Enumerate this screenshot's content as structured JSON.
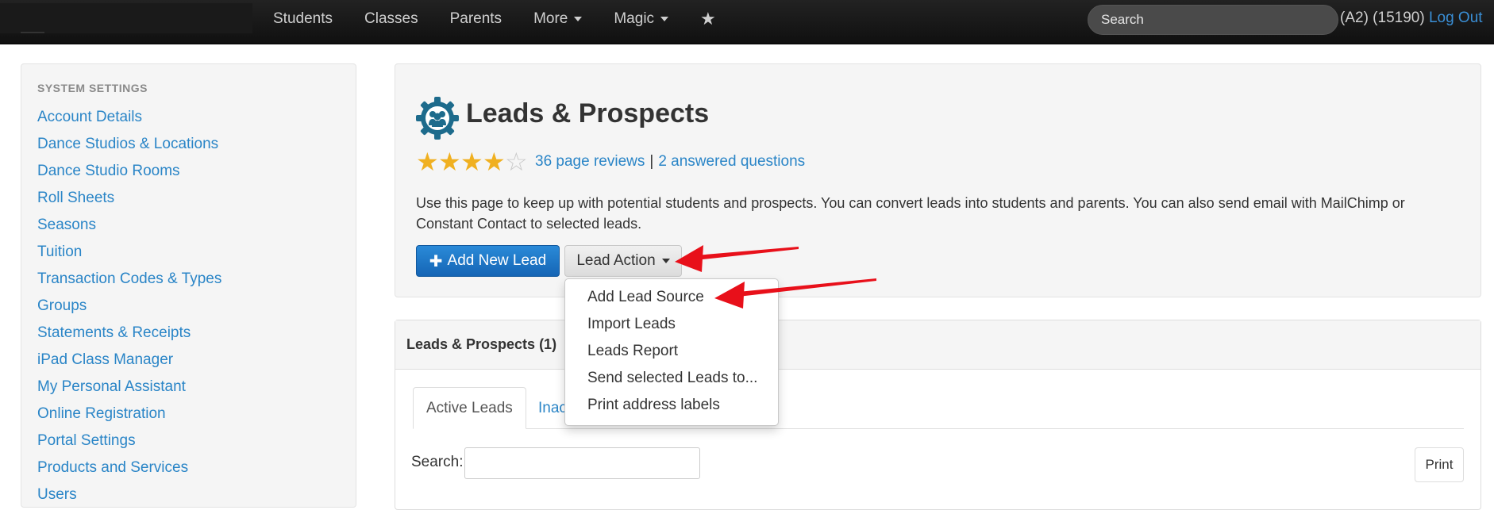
{
  "navbar": {
    "links": [
      {
        "label": "Students"
      },
      {
        "label": "Classes"
      },
      {
        "label": "Parents"
      },
      {
        "label": "More"
      },
      {
        "label": "Magic"
      }
    ],
    "star_icon": "star-icon",
    "search_placeholder": "Search",
    "user_info": "(A2) (15190)",
    "logout_label": "Log Out"
  },
  "sidebar": {
    "heading": "SYSTEM SETTINGS",
    "items": [
      {
        "label": "Account Details"
      },
      {
        "label": "Dance Studios & Locations"
      },
      {
        "label": "Dance Studio Rooms"
      },
      {
        "label": "Roll Sheets"
      },
      {
        "label": "Seasons"
      },
      {
        "label": "Tuition"
      },
      {
        "label": "Transaction Codes & Types"
      },
      {
        "label": "Groups"
      },
      {
        "label": "Statements & Receipts"
      },
      {
        "label": "iPad Class Manager"
      },
      {
        "label": "My Personal Assistant"
      },
      {
        "label": "Online Registration"
      },
      {
        "label": "Portal Settings"
      },
      {
        "label": "Products and Services"
      },
      {
        "label": "Users"
      }
    ]
  },
  "page": {
    "title": "Leads & Prospects",
    "icon": "gear-people-icon",
    "rating": {
      "value": 4,
      "max": 5
    },
    "reviews_link": "36 page reviews",
    "separator": "|",
    "questions_link": "2 answered questions",
    "description": "Use this page to keep up with potential students and prospects. You can convert leads into students and parents. You can also send email with MailChimp or Constant Contact to selected leads.",
    "add_button": "Add New Lead",
    "action_button": "Lead Action"
  },
  "lead_action_menu": {
    "items": [
      {
        "label": "Add Lead Source"
      },
      {
        "label": "Import Leads"
      },
      {
        "label": "Leads Report"
      },
      {
        "label": "Send selected Leads to..."
      },
      {
        "label": "Print address labels"
      }
    ]
  },
  "leads_panel": {
    "title": "Leads & Prospects (1)",
    "tabs": [
      {
        "label": "Active Leads"
      },
      {
        "label": "Inac"
      }
    ],
    "search_label": "Search:",
    "search_value": "",
    "print_button": "Print"
  },
  "colors": {
    "navbar": "#141414",
    "link": "#2a85c7",
    "primary": "#1a6fc0",
    "star": "#f0b020",
    "arrow": "#e8101a"
  }
}
